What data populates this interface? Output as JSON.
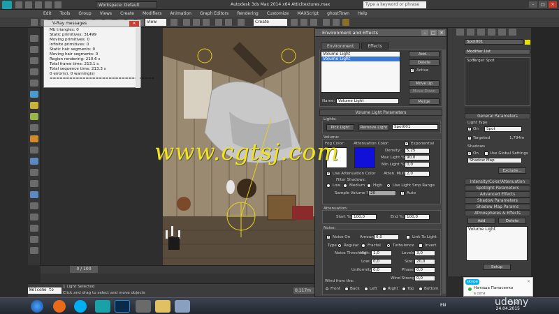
{
  "titlebar": {
    "workspace": "Workspace: Default",
    "title": "Autodesk 3ds Max  2014 x64    Atticltextures.max",
    "search_placeholder": "Type a keyword or phrase"
  },
  "menubar": [
    "Edit",
    "Tools",
    "Group",
    "Views",
    "Create",
    "Modifiers",
    "Animation",
    "Graph Editors",
    "Rendering",
    "Customize",
    "MAXScript",
    "ghostTown",
    "Help"
  ],
  "toolbar": {
    "view_select": "View",
    "selection_set": "Create Selection Se"
  },
  "vray": {
    "title": "V-Ray messages",
    "lines": [
      "Mb triangles: 0",
      "Static primitives: 31499",
      "Moving primitives: 0",
      "Infinite primitives: 0",
      "Static hair segments: 0",
      "Moving hair segments: 0",
      "Region rendering: 210.6 s",
      "Total frame time: 213.1 s",
      "Total sequence time: 213.3 s",
      "0 error(s), 0 warning(s)",
      "================================"
    ]
  },
  "watermark": "www.cgtsj.com",
  "env": {
    "title": "Environment and Effects",
    "tabs": [
      "Environment",
      "Effects"
    ],
    "effects_list": [
      "Volume Light",
      "Volume Light"
    ],
    "buttons": {
      "add": "Add...",
      "delete": "Delete",
      "move_up": "Move Up",
      "move_down": "Move Down",
      "merge": "Merge"
    },
    "active_label": "Active",
    "name_label": "Name:",
    "name_value": "Volume Light",
    "params_title": "Volume Light Parameters",
    "lights_label": "Lights:",
    "pick_light": "Pick Light",
    "remove_light": "Remove Light",
    "light_select": "Spot001",
    "volume_label": "Volume:",
    "fog_color": "Fog Color:",
    "atten_color": "Attenuation Color:",
    "exponential": "Exponential",
    "density_label": "Density:",
    "density": "5,25",
    "max_light_label": "Max Light %:",
    "max_light": "90,0",
    "min_light_label": "Min Light %:",
    "min_light": "0,0",
    "use_atten": "Use Attenuation Color",
    "atten_mult_label": "Atten. Mult.:",
    "atten_mult": "2,0",
    "filter_shadows": "Filter Shadows:",
    "shadow_opts": [
      "Low",
      "Medium",
      "High",
      "Use Light Smp Range"
    ],
    "sample_volume_label": "Sample Volume %:",
    "sample_volume": "20",
    "auto_label": "Auto",
    "attenuation_label": "Attenuation:",
    "start_label": "Start %:",
    "start": "100,0",
    "end_label": "End %:",
    "end": "100,0",
    "noise_label": "Noise:",
    "noise_on": "Noise On",
    "amount_label": "Amount:",
    "amount": "0,0",
    "link_to_light": "Link To Light",
    "type_label": "Type:",
    "type_opts": [
      "Regular",
      "Fractal",
      "Turbulence"
    ],
    "invert": "Invert",
    "noise_threshold": "Noise Threshold:",
    "high_label": "High:",
    "high": "1,0",
    "levels_label": "Levels:",
    "levels": "3,0",
    "low_label": "Low:",
    "low": "0,0",
    "size_label": "Size:",
    "size": "20,0",
    "uniformity_label": "Uniformity:",
    "uniformity": "0,0",
    "phase_label": "Phase:",
    "phase": "0,0",
    "wind_strength_label": "Wind Strength:",
    "wind_strength": "0,0",
    "wind_from": "Wind from the:",
    "wind_opts": [
      "Front",
      "Back",
      "Left",
      "Right",
      "Top",
      "Bottom"
    ]
  },
  "cmd": {
    "object_name": "Spot001",
    "modifier_list": "Modifier List",
    "stack": [
      "Spot",
      "Target Spot"
    ],
    "general": "General Parameters",
    "light_type": "Light Type",
    "on_label": "On",
    "type_value": "Spot",
    "targeted": "Targeted",
    "target_dist": "1,794m",
    "shadows": "Shadows",
    "use_global": "Use Global Settings",
    "shadow_type": "Shadow Map",
    "exclude": "Exclude...",
    "rollouts": [
      "Intensity/Color/Attenuation",
      "Spotlight Parameters",
      "Advanced Effects",
      "Shadow Parameters",
      "Shadow Map Params",
      "Atmospheres & Effects"
    ],
    "add": "Add",
    "delete": "Delete",
    "atmos_item": "Volume Light",
    "setup": "Setup"
  },
  "timeline": {
    "frame": "0 / 100"
  },
  "status": {
    "welcome": "Welcome to",
    "selected": "1 Light Selected",
    "hint": "Click and drag to select and move objects",
    "coord": "0,117m"
  },
  "notif": {
    "app": "skype",
    "name": "Наташа Панасенко",
    "status": "в сети"
  },
  "taskbar": {
    "lang": "EN",
    "time": "19:42",
    "date": "24.04.2015"
  },
  "brand": "udemy"
}
